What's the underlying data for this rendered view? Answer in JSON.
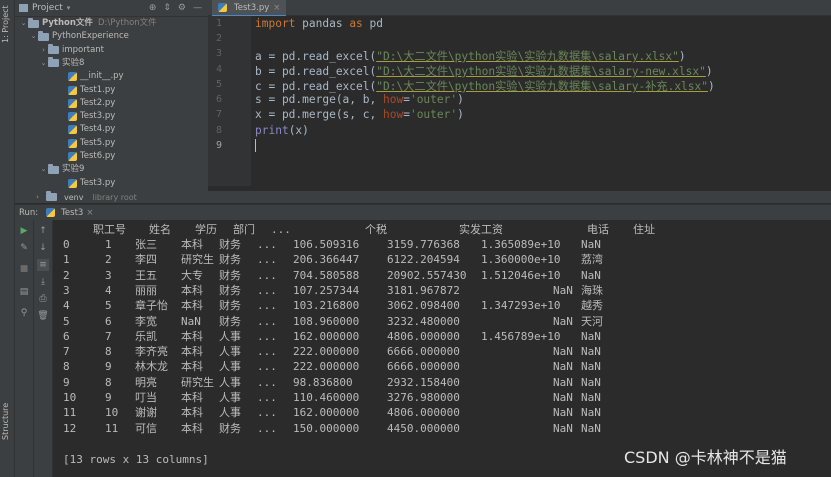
{
  "left_strip": {
    "project_label": "1: Project",
    "structure_label": "Structure"
  },
  "project_panel": {
    "title": "Project",
    "tree": [
      {
        "label": "Python文件",
        "hint": "D:\\Python文件",
        "type": "folder",
        "expanded": true
      },
      {
        "label": "PythonExperience",
        "type": "folder",
        "expanded": true
      },
      {
        "label": "important",
        "type": "folder",
        "expanded": false
      },
      {
        "label": "实验8",
        "type": "folder",
        "expanded": true
      },
      {
        "label": "__init__.py",
        "type": "py"
      },
      {
        "label": "Test1.py",
        "type": "py"
      },
      {
        "label": "Test2.py",
        "type": "py"
      },
      {
        "label": "Test3.py",
        "type": "py"
      },
      {
        "label": "Test4.py",
        "type": "py"
      },
      {
        "label": "Test5.py",
        "type": "py"
      },
      {
        "label": "Test6.py",
        "type": "py"
      },
      {
        "label": "实验9",
        "type": "folder",
        "expanded": true
      },
      {
        "label": "Test3.py",
        "type": "py"
      }
    ],
    "venv": {
      "label": "venv",
      "hint": "library root"
    }
  },
  "editor": {
    "tab_label": "Test3.py",
    "line_numbers": [
      "1",
      "2",
      "3",
      "4",
      "5",
      "6",
      "7",
      "8",
      "9"
    ],
    "code": {
      "l1_kw1": "import",
      "l1_mid": " pandas ",
      "l1_kw2": "as",
      "l1_end": " pd",
      "l3_pre": "a = pd.read_excel(",
      "l3_str": "\"D:\\大二文件\\python实验\\实验九数据集\\salary.xlsx\"",
      "l3_end": ")",
      "l4_pre": "b = pd.read_excel(",
      "l4_str": "\"D:\\大二文件\\python实验\\实验九数据集\\salary-new.xlsx\"",
      "l4_end": ")",
      "l5_pre": "c = pd.read_excel(",
      "l5_str": "\"D:\\大二文件\\python实验\\实验九数据集\\salary-补充.xlsx\"",
      "l5_end": ")",
      "l6_pre": "s = pd.merge(a, b, ",
      "l6_kw": "how",
      "l6_eq": "=",
      "l6_str": "'outer'",
      "l6_end": ")",
      "l7_pre": "x = pd.merge(s, c, ",
      "l7_kw": "how",
      "l7_eq": "=",
      "l7_str": "'outer'",
      "l7_end": ")",
      "l8_fn": "print",
      "l8_end": "(x)"
    }
  },
  "run_panel": {
    "run_label": "Run:",
    "tab_label": "Test3",
    "header_row": [
      "职工号",
      "姓名",
      "学历",
      "部门",
      "...",
      "个税",
      "实发工资",
      "电话",
      "住址"
    ],
    "rows": [
      [
        "0",
        "1",
        "张三",
        "本科",
        "财务",
        "...",
        "106.509316",
        "3159.776368",
        "1.365089e+10",
        "NaN",
        ""
      ],
      [
        "1",
        "2",
        "李四",
        "研究生",
        "财务",
        "...",
        "206.366447",
        "6122.204594",
        "1.360000e+10",
        "荔湾",
        ""
      ],
      [
        "2",
        "3",
        "王五",
        "大专",
        "财务",
        "...",
        "704.580588",
        "20902.557430",
        "1.512046e+10",
        "NaN",
        ""
      ],
      [
        "3",
        "4",
        "丽丽",
        "本科",
        "财务",
        "...",
        "107.257344",
        "3181.967872",
        "NaN",
        "海珠",
        ""
      ],
      [
        "4",
        "5",
        "章子怡",
        "本科",
        "财务",
        "...",
        "103.216800",
        "3062.098400",
        "1.347293e+10",
        "越秀",
        ""
      ],
      [
        "5",
        "6",
        "李宽",
        "NaN",
        "财务",
        "...",
        "108.960000",
        "3232.480000",
        "NaN",
        "天河",
        ""
      ],
      [
        "6",
        "7",
        "乐凯",
        "本科",
        "人事",
        "...",
        "162.000000",
        "4806.000000",
        "1.456789e+10",
        "NaN",
        ""
      ],
      [
        "7",
        "8",
        "李齐亮",
        "本科",
        "人事",
        "...",
        "222.000000",
        "6666.000000",
        "NaN",
        "NaN",
        ""
      ],
      [
        "8",
        "9",
        "林木龙",
        "本科",
        "人事",
        "...",
        "222.000000",
        "6666.000000",
        "NaN",
        "NaN",
        ""
      ],
      [
        "9",
        "8",
        "明亮",
        "研究生",
        "人事",
        "...",
        "98.836800",
        "2932.158400",
        "NaN",
        "NaN",
        ""
      ],
      [
        "10",
        "9",
        "叮当",
        "本科",
        "人事",
        "...",
        "110.460000",
        "3276.980000",
        "NaN",
        "NaN",
        ""
      ],
      [
        "11",
        "10",
        "谢谢",
        "本科",
        "人事",
        "...",
        "162.000000",
        "4806.000000",
        "NaN",
        "NaN",
        ""
      ],
      [
        "12",
        "11",
        "可信",
        "本科",
        "财务",
        "...",
        "150.000000",
        "4450.000000",
        "NaN",
        "NaN",
        ""
      ]
    ],
    "summary": "[13 rows x 13 columns]"
  },
  "watermark": "CSDN @卡林神不是猫"
}
